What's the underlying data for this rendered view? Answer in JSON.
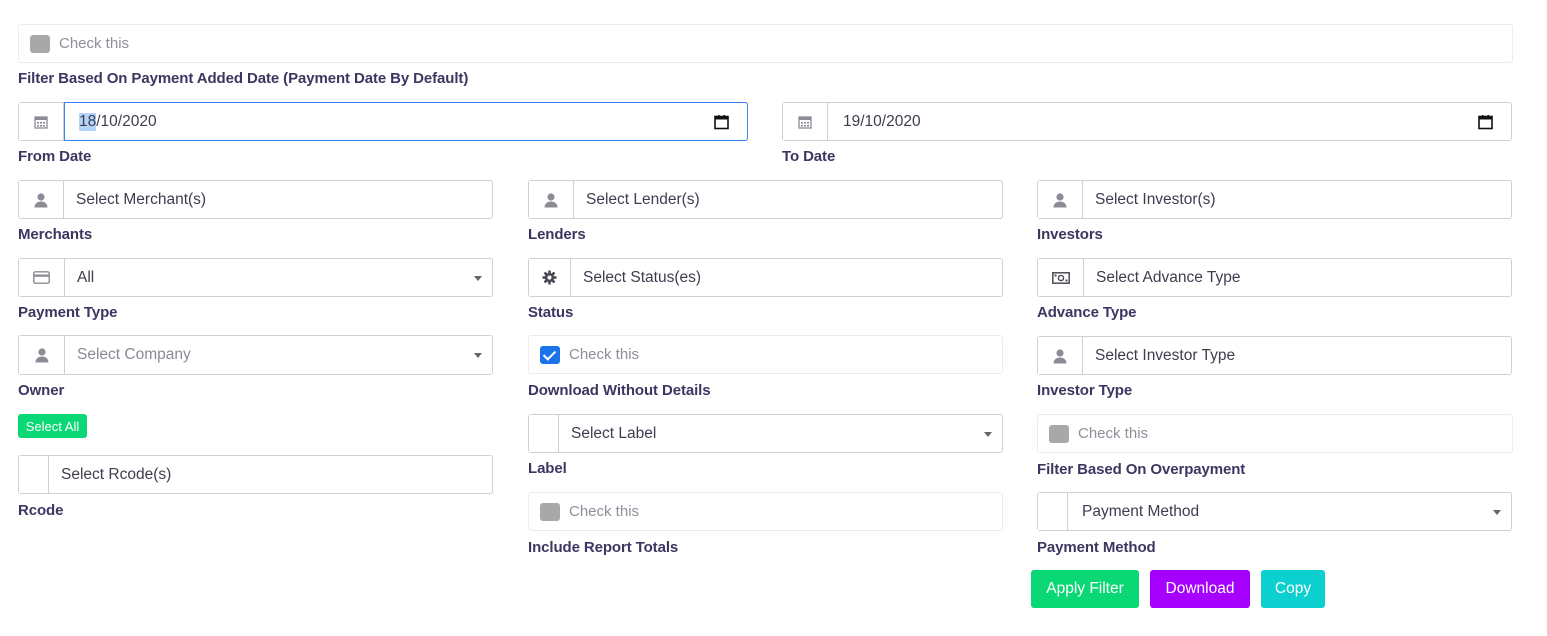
{
  "top_check": {
    "label": "Check this",
    "checked": false
  },
  "date_filter": {
    "heading": "Filter Based On Payment Added Date (Payment Date By Default)",
    "from": {
      "day": "18",
      "rest": "/10/2020",
      "label": "From Date"
    },
    "to": {
      "value": "19/10/2020",
      "label": "To Date"
    }
  },
  "merchants": {
    "placeholder": "Select Merchant(s)",
    "label": "Merchants"
  },
  "lenders": {
    "placeholder": "Select Lender(s)",
    "label": "Lenders"
  },
  "investors": {
    "placeholder": "Select Investor(s)",
    "label": "Investors"
  },
  "payment_type": {
    "value": "All",
    "label": "Payment Type"
  },
  "status": {
    "placeholder": "Select Status(es)",
    "label": "Status"
  },
  "advance_type": {
    "placeholder": "Select Advance Type",
    "label": "Advance Type"
  },
  "owner": {
    "placeholder": "Select Company",
    "label": "Owner"
  },
  "download_without_details": {
    "check_label": "Check this",
    "checked": true,
    "label": "Download Without Details"
  },
  "investor_type": {
    "placeholder": "Select Investor Type",
    "label": "Investor Type"
  },
  "select_all": {
    "label": "Select All"
  },
  "label_field": {
    "placeholder": "Select Label",
    "label": "Label"
  },
  "overpayment": {
    "check_label": "Check this",
    "checked": false,
    "label": "Filter Based On Overpayment"
  },
  "rcode": {
    "placeholder": "Select Rcode(s)",
    "label": "Rcode"
  },
  "report_totals": {
    "check_label": "Check this",
    "checked": false,
    "label": "Include Report Totals"
  },
  "payment_method": {
    "placeholder": "Payment Method",
    "label": "Payment Method"
  },
  "actions": {
    "apply": "Apply Filter",
    "download": "Download",
    "copy": "Copy"
  },
  "colors": {
    "apply": "#0ad875",
    "download": "#a600ff",
    "copy": "#0ccfcf",
    "select_all": "#0ad875",
    "label": "#3d3660"
  },
  "icons": {
    "date": "calendar-icon",
    "user": "user-icon",
    "card": "credit-card-icon",
    "status": "gear-icon",
    "money": "money-icon"
  }
}
